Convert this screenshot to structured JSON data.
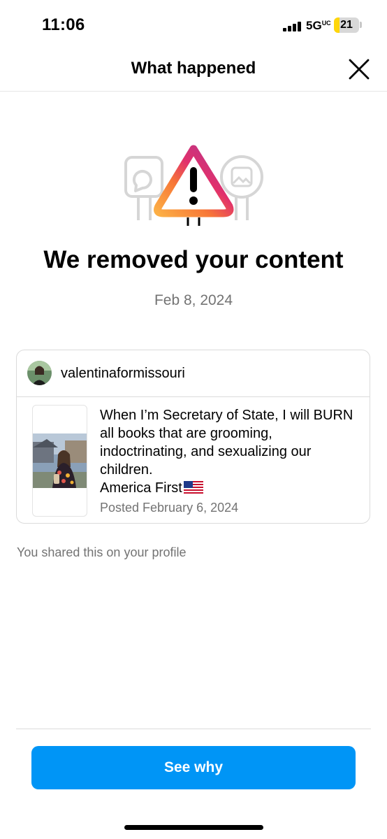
{
  "status_bar": {
    "time": "11:06",
    "network": "5G",
    "network_superscript": "UC",
    "battery_percent": "21",
    "battery_level": 0.21
  },
  "header": {
    "title": "What happened",
    "close_icon": "close-icon"
  },
  "notice": {
    "title": "We removed your content",
    "date": "Feb 8, 2024",
    "icon": "warning-triangle-icon",
    "gradient_colors": [
      "#feda75",
      "#fa7e1e",
      "#d62976",
      "#962fbf",
      "#4f5bd5"
    ]
  },
  "post": {
    "username": "valentinaformissouri",
    "caption": "When I’m Secretary of State, I will BURN all books that are grooming, indoctrinating, and sexualizing our children.\nAmerica First",
    "flag_icon": "us-flag-icon",
    "posted": "Posted February 6, 2024"
  },
  "shared_note": "You shared this on your profile",
  "actions": {
    "see_why_label": "See why",
    "accent": "#0095f6"
  }
}
